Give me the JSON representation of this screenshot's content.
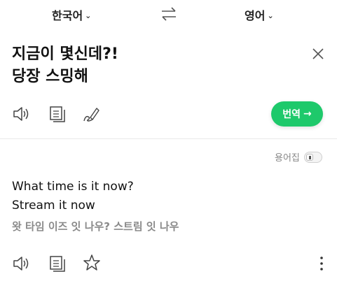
{
  "lang_bar": {
    "source_lang": "한국어",
    "target_lang": "영어",
    "chevron": "⌄",
    "swap_icon": "swap-arrows-icon"
  },
  "source": {
    "line1": "지금이 몇신데?!",
    "line2": "당장 스밍해"
  },
  "translate_button": {
    "label": "번역",
    "arrow": "→",
    "color": "#1ec96b"
  },
  "glossary": {
    "label": "용어집",
    "enabled": false
  },
  "result": {
    "line1": "What time is it now?",
    "line2": "Stream it now",
    "pronunciation": "왓 타임 이즈 잇 나우? 스트림 잇 나우"
  },
  "icons": {
    "speaker": "speaker-icon",
    "copy": "copy-icon",
    "handwriting": "pen-icon",
    "star": "star-icon",
    "close": "close-icon",
    "more": "more-vertical-icon"
  }
}
